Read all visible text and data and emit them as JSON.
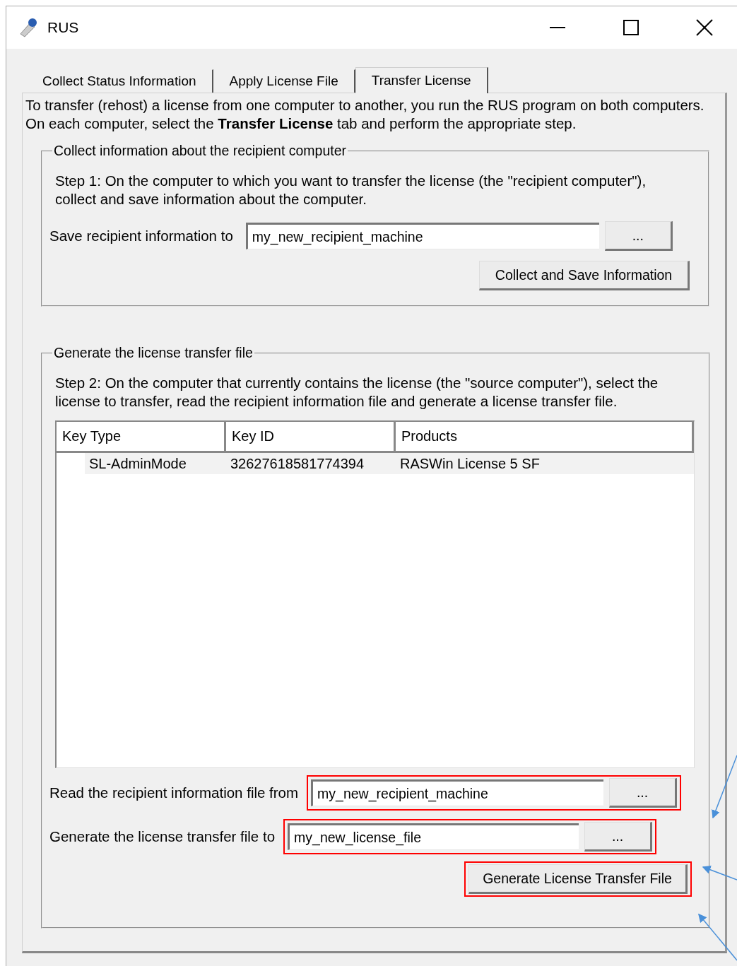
{
  "window": {
    "title": "RUS"
  },
  "tabs": [
    {
      "label": "Collect Status Information",
      "selected": false
    },
    {
      "label": "Apply License File",
      "selected": false
    },
    {
      "label": "Transfer License",
      "selected": true
    }
  ],
  "intro": "To transfer (rehost) a license from one computer to another, you run the RUS program on both computers. On each computer, select the **Transfer License** tab and perform the appropriate step.",
  "collect_group": {
    "legend": "Collect information about the recipient computer",
    "step": "Step 1: On the computer to which you want to transfer the license (the \"recipient computer\"), collect and save information about the computer.",
    "save_field": {
      "label": "Save recipient information to",
      "value": "my_new_recipient_machine",
      "browse": "...",
      "highlighted": false
    },
    "action": {
      "label": "Collect and Save Information",
      "highlighted": false
    }
  },
  "generate_group": {
    "legend": "Generate the license transfer file",
    "step": "Step 2: On the computer that currently contains the license (the \"source computer\"), select the license to transfer, read the recipient information file and generate a license transfer file.",
    "table": {
      "columns": [
        "Key Type",
        "Key ID",
        "Products"
      ],
      "rows": [
        {
          "key_type": "SL-AdminMode",
          "key_id": "32627618581774394",
          "products": "RASWin License 5 SF",
          "selected": false
        }
      ]
    },
    "read_field": {
      "label": "Read the recipient information file from",
      "value": "my_new_recipient_machine",
      "browse": "...",
      "highlighted": true
    },
    "output_field": {
      "label": "Generate the license transfer file to",
      "value": "my_new_license_file",
      "browse": "...",
      "highlighted": true
    },
    "action": {
      "label": "Generate License Transfer File",
      "highlighted": true
    }
  }
}
